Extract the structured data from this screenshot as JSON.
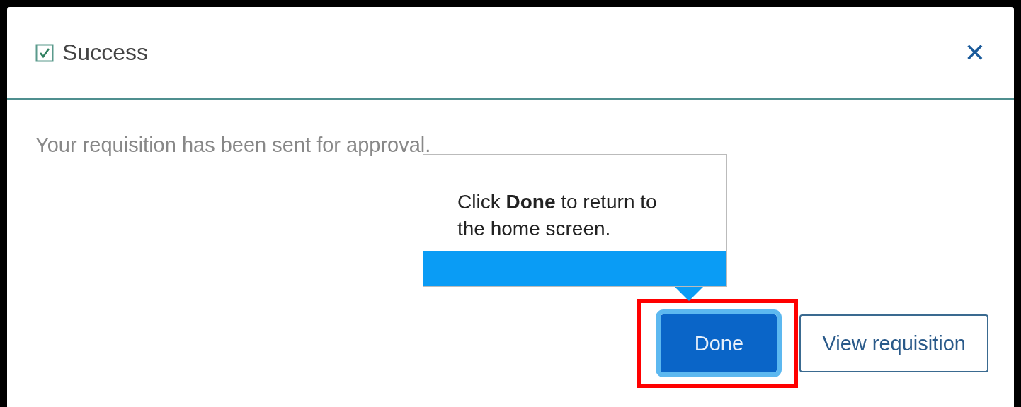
{
  "dialog": {
    "title": "Success",
    "title_checked": true,
    "close": "✕",
    "message": "Your requisition has been sent for approval."
  },
  "tooltip": {
    "text": "Click **Done** to return to the home screen."
  },
  "buttons": [
    {
      "label": "Done",
      "kind": "primary",
      "focused": true,
      "highlighted": true
    },
    {
      "label": "View requisition",
      "kind": "secondary",
      "focused": false,
      "highlighted": false
    }
  ]
}
